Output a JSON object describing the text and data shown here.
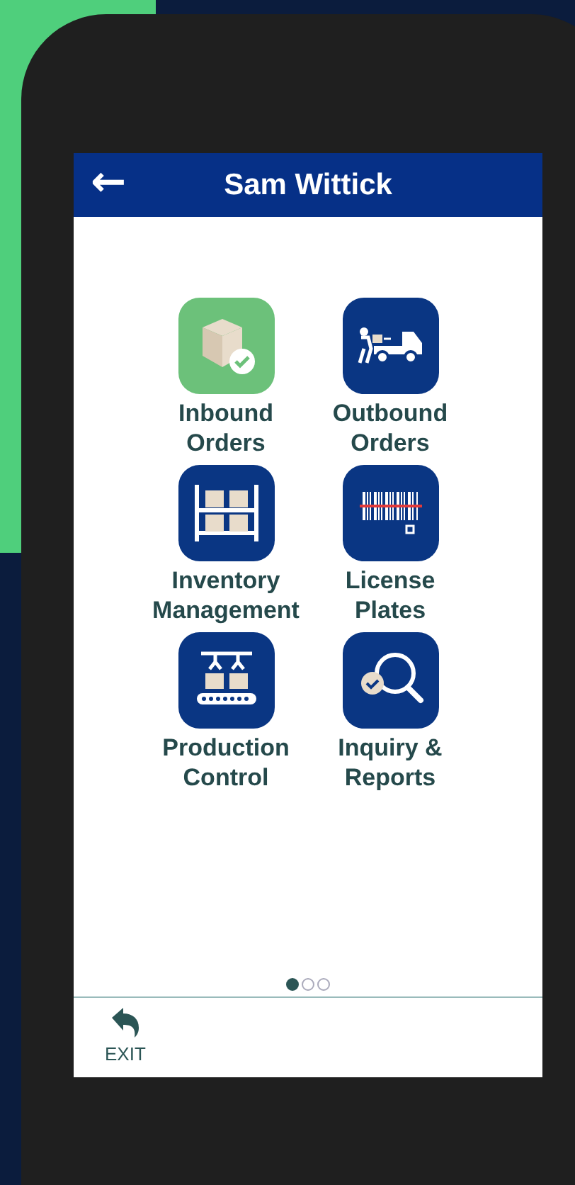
{
  "header": {
    "back": "←",
    "title": "Sam Wittick"
  },
  "tiles": [
    {
      "kind": "inbound",
      "label": "Inbound\nOrders",
      "color": "#6cc17a"
    },
    {
      "kind": "outbound",
      "label": "Outbound\nOrders",
      "color": "#0a3683"
    },
    {
      "kind": "inventory",
      "label": "Inventory\nManagement",
      "color": "#0a3683"
    },
    {
      "kind": "plates",
      "label": "License\nPlates",
      "color": "#0a3683"
    },
    {
      "kind": "production",
      "label": "Production\nControl",
      "color": "#0a3683"
    },
    {
      "kind": "inquiry",
      "label": "Inquiry &\nReports",
      "color": "#0a3683"
    }
  ],
  "pager": [
    {
      "selected": true
    },
    {
      "selected": false
    },
    {
      "selected": false
    }
  ],
  "footer": {
    "exit": "EXIT"
  }
}
